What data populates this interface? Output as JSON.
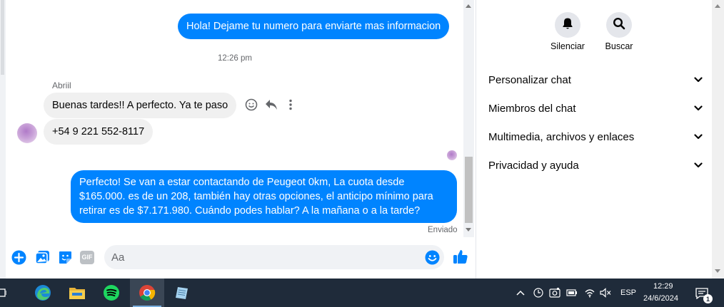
{
  "chat": {
    "messages": {
      "out1": "Hola! Dejame tu numero para enviarte mas informacion",
      "timestamp": "12:26 pm",
      "sender": "Abriil",
      "in1": "Buenas tardes!! A perfecto. Ya te paso",
      "in2": "+54 9 221 552-8117",
      "out2_line1": "Perfecto!  Se van a estar contactando de Peugeot 0km, La cuota desde",
      "out2_line2": "$165.000. es de un 208, también hay otras opciones, el anticipo mínimo para",
      "out2_line3": "retirar es de $7.171.980. Cuándo podes hablar? A la mañana o a la tarde?",
      "status": "Enviado"
    },
    "message_actions": [
      "emoji-react-icon",
      "reply-icon",
      "more-options-icon"
    ],
    "composer": {
      "placeholder": "Aa",
      "icons": [
        "plus-circle-icon",
        "attach-image-icon",
        "sticker-icon",
        "gif-icon",
        "emoji-icon",
        "thumbs-up-icon"
      ],
      "gif_label": "GIF"
    },
    "colors": {
      "outgoing": "#0084ff",
      "incoming": "#f0f0f0",
      "accent": "#0084ff"
    }
  },
  "panel": {
    "actions": [
      {
        "label": "Silenciar",
        "icon": "bell-icon"
      },
      {
        "label": "Buscar",
        "icon": "search-icon"
      }
    ],
    "sections": [
      {
        "label": "Personalizar chat"
      },
      {
        "label": "Miembros del chat"
      },
      {
        "label": "Multimedia, archivos y enlaces"
      },
      {
        "label": "Privacidad y ayuda"
      }
    ]
  },
  "taskbar": {
    "apps": [
      "task-view-icon",
      "edge-icon",
      "file-explorer-icon",
      "spotify-icon",
      "chrome-icon",
      "notepad-icon"
    ],
    "tray": {
      "language": "ESP",
      "time": "12:29",
      "date": "24/6/2024",
      "notification_count": "1"
    }
  }
}
